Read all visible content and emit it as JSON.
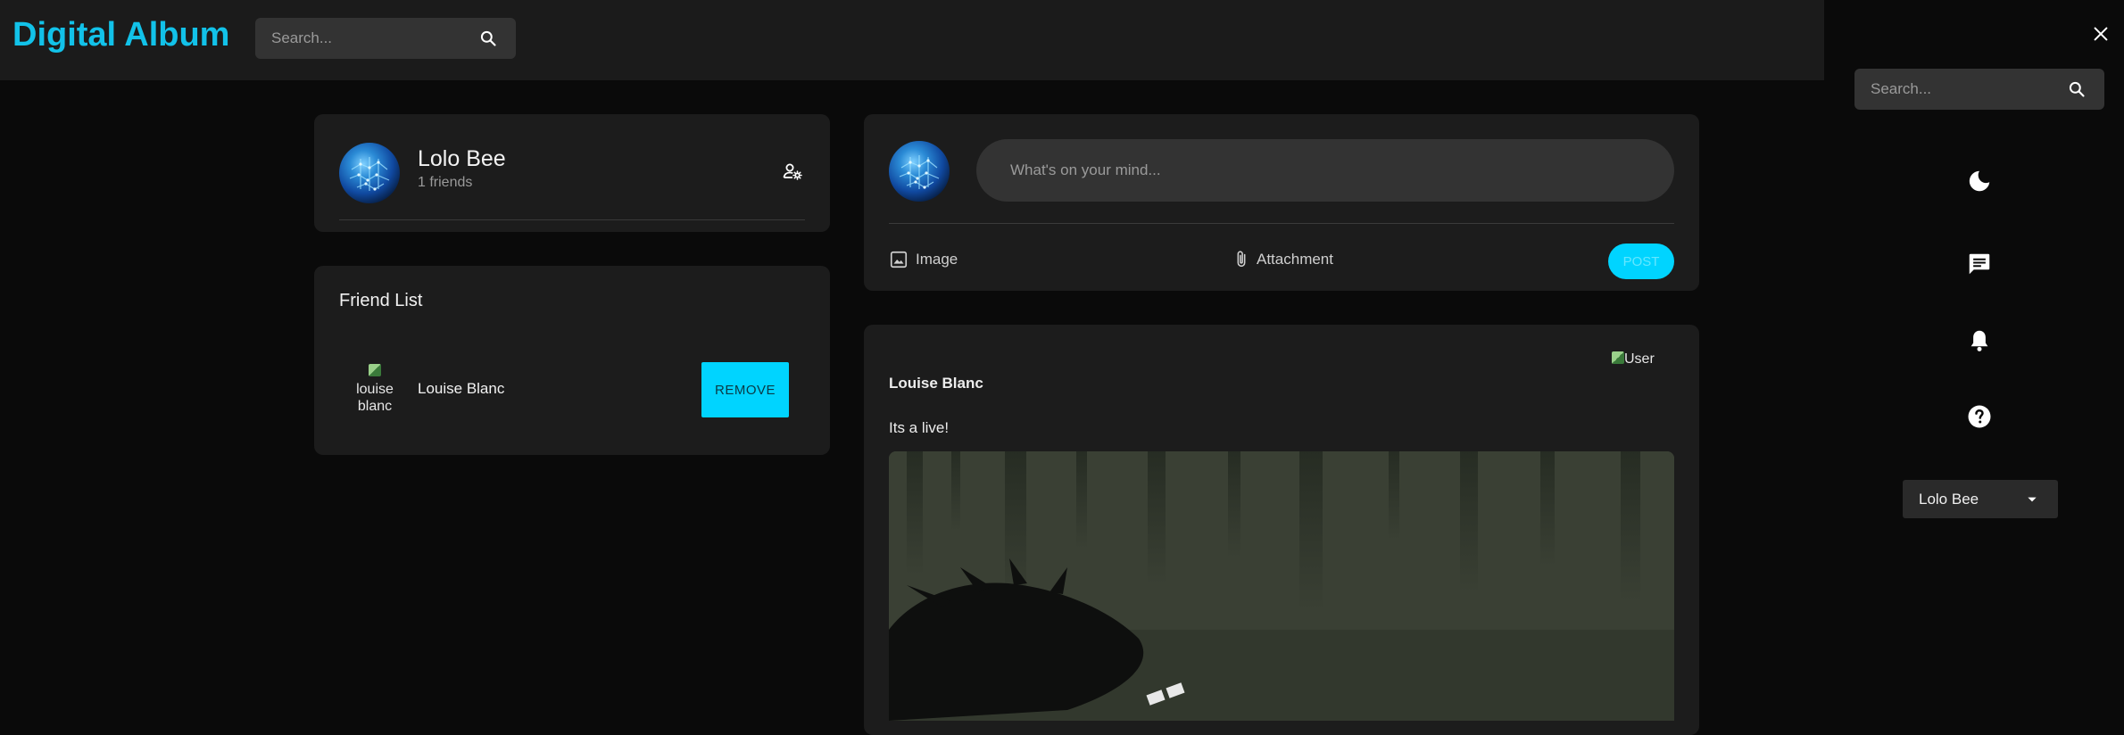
{
  "app": {
    "title": "Digital Album"
  },
  "header": {
    "search_placeholder": "Search..."
  },
  "profile": {
    "name": "Lolo Bee",
    "friends_count": "1 friends"
  },
  "friend_list": {
    "title": "Friend List",
    "items": [
      {
        "name": "Louise Blanc",
        "avatar_alt": "louise blanc",
        "action_label": "REMOVE"
      }
    ]
  },
  "composer": {
    "placeholder": "What's on your mind...",
    "image_label": "Image",
    "attachment_label": "Attachment",
    "post_label": "POST"
  },
  "post": {
    "author": "Louise Blanc",
    "text": "Its a live!",
    "avatar_alt": "User"
  },
  "sidebar": {
    "search_placeholder": "Search...",
    "current_user": "Lolo Bee"
  },
  "colors": {
    "accent": "#00d4ff",
    "brand": "#12c2e9",
    "background": "#0a0a0a",
    "card": "#1c1c1c"
  }
}
